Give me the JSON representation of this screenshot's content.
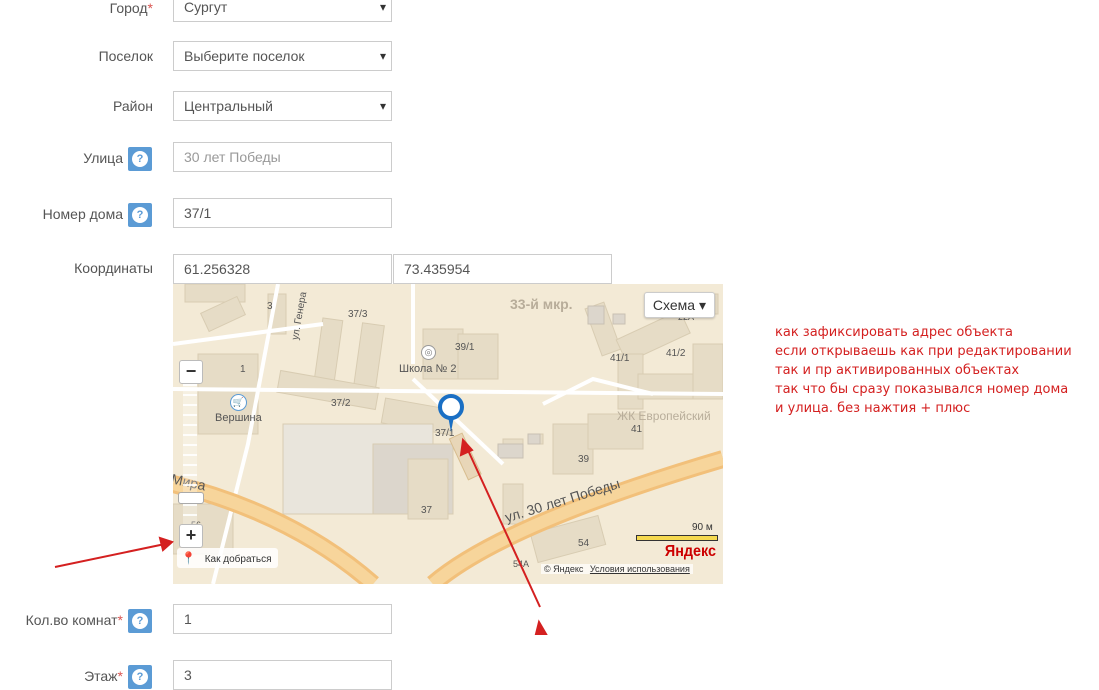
{
  "form": {
    "city": {
      "label": "Город",
      "required": "*",
      "value": "Сургут"
    },
    "settlement": {
      "label": "Поселок",
      "value": "Выберите поселок"
    },
    "district": {
      "label": "Район",
      "value": "Центральный"
    },
    "street": {
      "label": "Улица",
      "placeholder": "30 лет Победы"
    },
    "house": {
      "label": "Номер дома",
      "value": "37/1"
    },
    "coords": {
      "label": "Координаты",
      "lat": "61.256328",
      "lon": "73.435954"
    },
    "rooms": {
      "label": "Кол.во комнат",
      "required": "*",
      "value": "1"
    },
    "floor": {
      "label": "Этаж",
      "required": "*",
      "value": "3"
    },
    "help_glyph": "?"
  },
  "map": {
    "scheme_button": "Схема ▾",
    "route_label": "Как добраться",
    "scale_label": "90 м",
    "brand": "Яндекс",
    "copyright": "© Яндекс",
    "terms": "Условия использования",
    "labels": {
      "mkr": "33-й мкр.",
      "school": "Школа № 2",
      "vershina": "Вершина",
      "eurocomplex": "ЖК Европейский",
      "street_pobedy": "ул. 30 лет Победы",
      "street_mira": "Мира",
      "street_gener": "ул. Генера",
      "b3": "3",
      "b37_3": "37/3",
      "b39_1": "39/1",
      "b1": "1",
      "b37_2": "37/2",
      "b37_1": "37/1",
      "b37": "37",
      "b39": "39",
      "b41_1": "41/1",
      "b41_2": "41/2",
      "b41": "41",
      "b54": "54",
      "b54a": "54А",
      "b56": "56",
      "b22a": "22А"
    },
    "zoom_in": "+",
    "zoom_out": "−"
  },
  "note": [
    "как зафиксировать адрес объекта",
    "если открываешь как при редактировании",
    "так и пр активированных объектах",
    "так что бы сразу показывался номер дома",
    "и улица. без нажтия + плюс"
  ],
  "colors": {
    "annotation": "#d42020",
    "help": "#5b9bd5",
    "marker": "#1a6fc4"
  }
}
